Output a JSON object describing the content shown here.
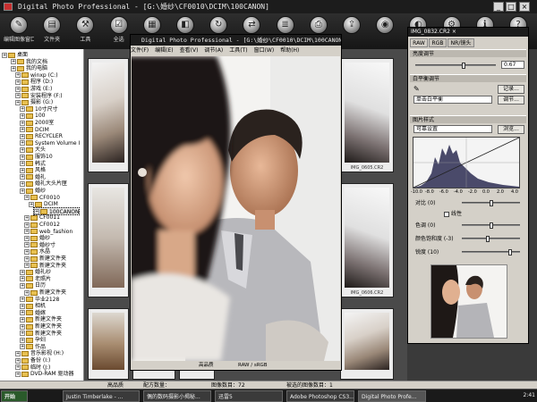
{
  "window": {
    "title": "Digital Photo Professional - [G:\\婚纱\\CF0010\\DCIM\\100CANON]",
    "minimize": "_",
    "maximize": "□",
    "close": "×"
  },
  "toolbar": [
    {
      "label": "编辑图像窗口",
      "icon": "edit-image-icon"
    },
    {
      "label": "文件夹",
      "icon": "folder-icon"
    },
    {
      "label": "工具",
      "icon": "tool-icon"
    },
    {
      "label": "全选",
      "icon": "select-all-icon"
    },
    {
      "label": "",
      "icon": "grid-icon"
    },
    {
      "label": "",
      "icon": "compare-icon"
    },
    {
      "label": "",
      "icon": "rotate-icon"
    },
    {
      "label": "",
      "icon": "convert-icon"
    },
    {
      "label": "",
      "icon": "batch-icon"
    },
    {
      "label": "",
      "icon": "print-icon"
    },
    {
      "label": "",
      "icon": "transfer-icon"
    },
    {
      "label": "",
      "icon": "camera-icon"
    },
    {
      "label": "",
      "icon": "palette-icon"
    },
    {
      "label": "",
      "icon": "settings-icon"
    },
    {
      "label": "",
      "icon": "info-icon"
    },
    {
      "label": "",
      "icon": "help-icon"
    }
  ],
  "tree": {
    "items": [
      {
        "label": "桌面"
      },
      {
        "label": "我的文档"
      },
      {
        "label": "我的电脑"
      },
      {
        "label": "winxp (C:)"
      },
      {
        "label": "程序 (D:)"
      },
      {
        "label": "游戏 (E:)"
      },
      {
        "label": "安装程序 (F:)"
      },
      {
        "label": "摄影 (G:)"
      },
      {
        "label": "10寸尺寸"
      },
      {
        "label": "100"
      },
      {
        "label": "2000室"
      },
      {
        "label": "DCIM"
      },
      {
        "label": "RECYCLER"
      },
      {
        "label": "System Volume I"
      },
      {
        "label": "大头"
      },
      {
        "label": "服饰10"
      },
      {
        "label": "韩式"
      },
      {
        "label": "风格"
      },
      {
        "label": "婚礼"
      },
      {
        "label": "婚礼大头片匣"
      },
      {
        "label": "婚纱"
      },
      {
        "label": "CF0010"
      },
      {
        "label": "DCIM"
      },
      {
        "label": "100CANON"
      },
      {
        "label": "CF0011"
      },
      {
        "label": "CF0012"
      },
      {
        "label": "web_fashion"
      },
      {
        "label": "婚纱"
      },
      {
        "label": "婚纱寸"
      },
      {
        "label": "水晶"
      },
      {
        "label": "新建文件夹"
      },
      {
        "label": "新建文件夹"
      },
      {
        "label": "婚礼纱"
      },
      {
        "label": "老照片"
      },
      {
        "label": "日历"
      },
      {
        "label": "新建文件夹"
      },
      {
        "label": "毕业2128"
      },
      {
        "label": "相机"
      },
      {
        "label": "婚嫁"
      },
      {
        "label": "新建文件夹"
      },
      {
        "label": "新建文件夹"
      },
      {
        "label": "新建文件夹"
      },
      {
        "label": "孕妇"
      },
      {
        "label": "作品"
      },
      {
        "label": "音乐影视 (H:)"
      },
      {
        "label": "备份 (I:)"
      },
      {
        "label": "临时 (J:)"
      },
      {
        "label": "DVD-RAM 驱动器"
      }
    ]
  },
  "thumbnails": [
    {
      "caption": ""
    },
    {
      "caption": "IMG_0605.CR2"
    },
    {
      "caption": ""
    },
    {
      "caption": ""
    },
    {
      "caption": "IMG_0606.CR2"
    },
    {
      "caption": ""
    },
    {
      "caption": ""
    },
    {
      "caption": ""
    }
  ],
  "preview": {
    "title": "Digital Photo Professional - [G:\\婚纱\\CF0010\\DCIM\\100CANON]",
    "menu": [
      "文件(F)",
      "编辑(E)",
      "查看(V)",
      "调节(A)",
      "工具(T)",
      "窗口(W)",
      "帮助(H)"
    ],
    "status_left": "高品质",
    "status_right": "RAW / sRGB"
  },
  "panel": {
    "title": "IMG_0832.CR2 ×",
    "tabs": [
      "RAW",
      "RGB",
      "NR/镜头"
    ],
    "brightness_label": "亮度调节",
    "brightness_value": "0.67",
    "wb_label": "白平衡调节",
    "wb_record_button": "记录...",
    "wb_mode": "单击白平衡",
    "wb_adjust_button": "调节...",
    "style_label": "图片样式",
    "style_value": "可靠设置",
    "style_browse_button": "浏览...",
    "histo_ticks": [
      "-10.0",
      "-8.0",
      "-6.0",
      "-4.0",
      "-2.0",
      "0.0",
      "2.0",
      "4.0"
    ],
    "contrast_label": "对比 (0)",
    "linear_label": "线性",
    "hue_label": "色调 (0)",
    "saturation_label": "颜色饱和度 (-3)",
    "sharpness_label": "锐度 (10)",
    "brightness_level": 0.6,
    "contrast_level": 0.5,
    "hue_level": 0.5,
    "saturation_level": 0.45,
    "sharpness_level": 0.85
  },
  "statusbar": {
    "quality": "高品质",
    "sort": "配方数量：",
    "image_count": "图像数目：72",
    "selected": "被选的图像数目：1"
  },
  "taskbar": {
    "start": "开始",
    "tasks": [
      "Justin Timberlake - ...",
      "偶的数码摄影小揭秘...",
      "迅雷5",
      "Adobe Photoshop CS3...",
      "Digital Photo Profe..."
    ],
    "clock": "2:41"
  },
  "colors": {
    "titlebar": "#1c1c1c",
    "folder": "#e8c050",
    "panel": "#d4d0c8"
  }
}
